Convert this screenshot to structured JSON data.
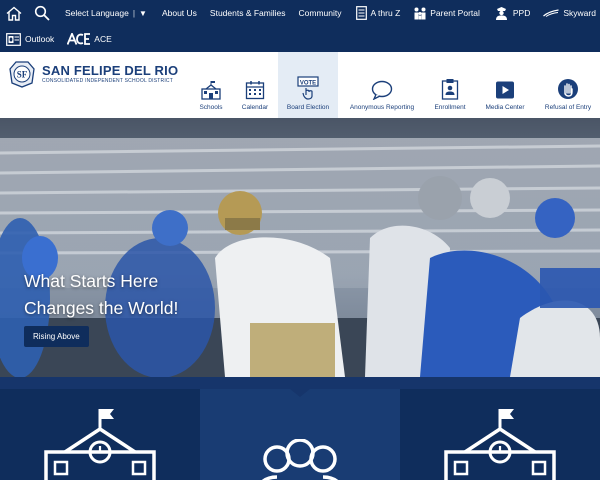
{
  "topbar": {
    "row1": [
      {
        "icon": "home-icon",
        "label": ""
      },
      {
        "icon": "search-icon",
        "label": ""
      },
      {
        "icon": "",
        "label": "Select Language"
      },
      {
        "icon": "",
        "label": "About Us"
      },
      {
        "icon": "",
        "label": "Students & Families"
      },
      {
        "icon": "",
        "label": "Community"
      },
      {
        "icon": "document-list-icon",
        "label": "A thru Z"
      },
      {
        "icon": "family-icon",
        "label": "Parent Portal"
      },
      {
        "icon": "police-icon",
        "label": "PPD"
      },
      {
        "icon": "skyward-icon",
        "label": "Skyward"
      }
    ],
    "row2": [
      {
        "icon": "outlook-icon",
        "label": "Outlook"
      },
      {
        "icon": "ace-logo-icon",
        "label": "ACE"
      }
    ],
    "dropdown_arrow": "▼"
  },
  "header": {
    "logo": {
      "name": "SAN FELIPE DEL RIO",
      "subtitle": "CONSOLIDATED INDEPENDENT SCHOOL DISTRICT",
      "emblem": "SF"
    },
    "nav": [
      {
        "icon": "school-icon",
        "label": "Schools",
        "active": false
      },
      {
        "icon": "calendar-icon",
        "label": "Calendar",
        "active": false
      },
      {
        "icon": "vote-icon",
        "label": "Board Election",
        "active": true,
        "icon_text": "VOTE"
      },
      {
        "icon": "speech-bubble-icon",
        "label": "Anonymous Reporting",
        "active": false
      },
      {
        "icon": "clipboard-icon",
        "label": "Enrollment",
        "active": false
      },
      {
        "icon": "play-icon",
        "label": "Media Center",
        "active": false
      },
      {
        "icon": "hand-stop-icon",
        "label": "Refusal of Entry",
        "active": false
      }
    ]
  },
  "hero": {
    "line1": "What Starts Here",
    "line2": "Changes the World!",
    "button": "Rising Above"
  },
  "tiles": [
    {
      "icon": "school-building-icon",
      "bg": "#0f2d5c"
    },
    {
      "icon": "people-group-icon",
      "bg": "#193c73"
    },
    {
      "icon": "school-building-icon",
      "bg": "#0f2d5c"
    }
  ],
  "colors": {
    "navy": "#0f2d5c",
    "brand_blue": "#1b3f7a",
    "active_nav": "#e4ecf5"
  }
}
